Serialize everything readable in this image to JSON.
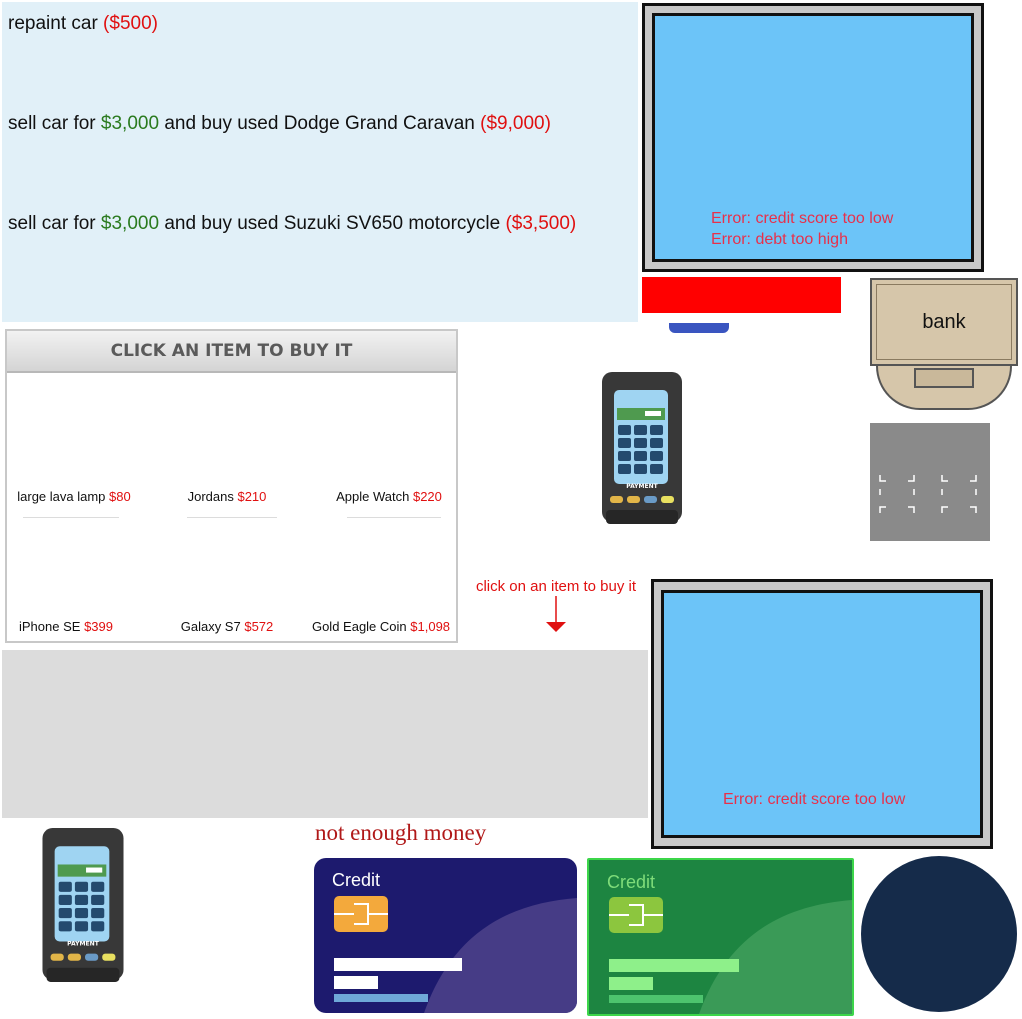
{
  "options": {
    "repaint": {
      "text": "repaint car ",
      "cost": "($500)"
    },
    "caravan": {
      "pre": "sell car for ",
      "gain": "$3,000",
      "mid": " and buy used Dodge Grand Caravan ",
      "cost": "($9,000)"
    },
    "motorcycle": {
      "pre": "sell car for ",
      "gain": "$3,000",
      "mid": " and buy used Suzuki SV650 motorcycle ",
      "cost": "($3,500)"
    }
  },
  "monitor_top": {
    "errors": [
      "Error: credit score too low",
      "Error: debt too high"
    ]
  },
  "monitor_bottom": {
    "errors": [
      "Error: credit score too low"
    ]
  },
  "bank": {
    "label": "bank"
  },
  "store": {
    "header": "CLICK AN ITEM TO BUY IT",
    "items": [
      {
        "name": "large lava lamp",
        "price": "$80"
      },
      {
        "name": "Jordans",
        "price": "$210"
      },
      {
        "name": "Apple Watch",
        "price": "$220"
      },
      {
        "name": "iPhone SE",
        "price": "$399"
      },
      {
        "name": "Galaxy S7",
        "price": "$572"
      },
      {
        "name": "Gold Eagle Coin",
        "price": "$1,098"
      }
    ]
  },
  "hint": {
    "text": "click on an item to buy it"
  },
  "terminal": {
    "label": "PAYMENT"
  },
  "status": {
    "no_money": "not enough money"
  },
  "cards": {
    "blue": {
      "label": "Credit"
    },
    "green": {
      "label": "Credit"
    }
  },
  "colors": {
    "cost": "#e01010",
    "gain": "#2a7a1e",
    "screen": "#6cc4f8",
    "error": "#e8304a",
    "card_blue": "#1d1a6e",
    "card_green": "#1d8541"
  }
}
